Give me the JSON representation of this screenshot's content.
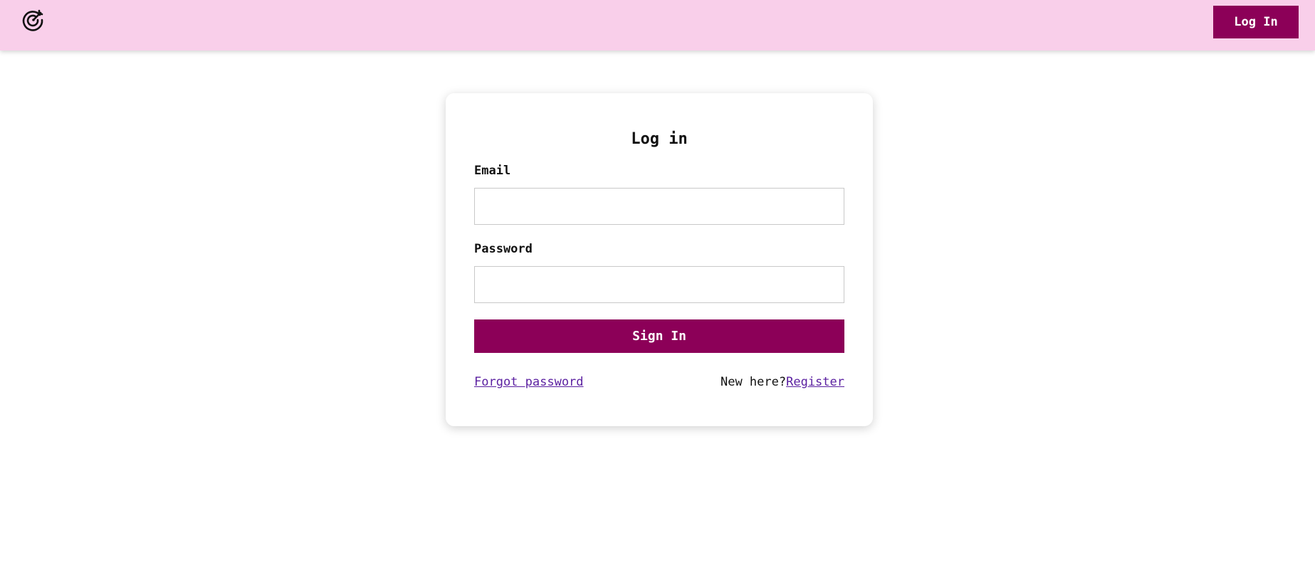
{
  "header": {
    "logo_icon": "target-icon",
    "login_label": "Log In"
  },
  "colors": {
    "header_bg": "#f9cfea",
    "primary": "#8c0058",
    "link": "#5a1fa0"
  },
  "login_form": {
    "title": "Log in",
    "email_label": "Email",
    "email_value": "",
    "password_label": "Password",
    "password_value": "",
    "submit_label": "Sign In",
    "forgot_password_label": "Forgot password",
    "register_prompt": "New here?",
    "register_label": "Register"
  }
}
